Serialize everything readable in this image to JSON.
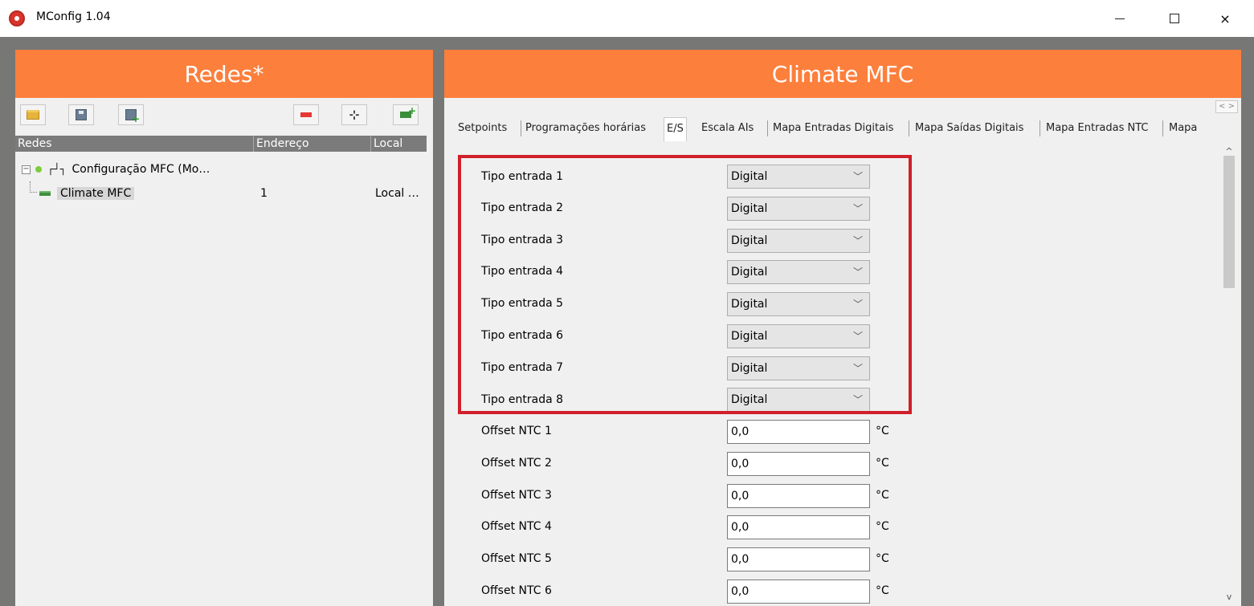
{
  "window": {
    "title": "MConfig 1.04",
    "icon": "app-logo-icon",
    "controls": {
      "minimize": "minimize-icon",
      "maximize": "maximize-icon",
      "close": "×"
    }
  },
  "left_panel": {
    "title": "Redes*",
    "toolbar": [
      "open-folder-icon",
      "save-icon",
      "save-as-icon",
      "remove-icon",
      "add-network-icon",
      "add-device-icon"
    ],
    "tree_columns": [
      "Redes",
      "Endereço",
      "Local"
    ],
    "tree": {
      "expander": "−",
      "network_icon": "┌┘┐",
      "network_label": "Configuração MFC (Mo…",
      "device": {
        "name": "Climate MFC",
        "address": "1",
        "local": "Local …"
      }
    }
  },
  "right_panel": {
    "title": "Climate MFC",
    "tabs": [
      "Setpoints",
      "Programações horárias",
      "E/S",
      "Escala AIs",
      "Mapa Entradas Digitais",
      "Mapa Saídas Digitais",
      "Mapa Entradas NTC",
      "Mapa"
    ],
    "active_tab": "E/S",
    "tab_scroll": "< >",
    "inputs": [
      {
        "label": "Tipo entrada 1",
        "value": "Digital"
      },
      {
        "label": "Tipo entrada 2",
        "value": "Digital"
      },
      {
        "label": "Tipo entrada 3",
        "value": "Digital"
      },
      {
        "label": "Tipo entrada 4",
        "value": "Digital"
      },
      {
        "label": "Tipo entrada 5",
        "value": "Digital"
      },
      {
        "label": "Tipo entrada 6",
        "value": "Digital"
      },
      {
        "label": "Tipo entrada 7",
        "value": "Digital"
      },
      {
        "label": "Tipo entrada 8",
        "value": "Digital"
      }
    ],
    "offsets": [
      {
        "label": "Offset NTC 1",
        "value": "0,0",
        "unit": "°C"
      },
      {
        "label": "Offset NTC 2",
        "value": "0,0",
        "unit": "°C"
      },
      {
        "label": "Offset NTC 3",
        "value": "0,0",
        "unit": "°C"
      },
      {
        "label": "Offset NTC 4",
        "value": "0,0",
        "unit": "°C"
      },
      {
        "label": "Offset NTC 5",
        "value": "0,0",
        "unit": "°C"
      },
      {
        "label": "Offset NTC 6",
        "value": "0,0",
        "unit": "°C"
      }
    ],
    "chevron": "﹀",
    "scroll_up": "^",
    "scroll_down": "v"
  },
  "colors": {
    "header": "#fc7f3c",
    "highlight": "#d01f2a",
    "background": "#777776"
  }
}
